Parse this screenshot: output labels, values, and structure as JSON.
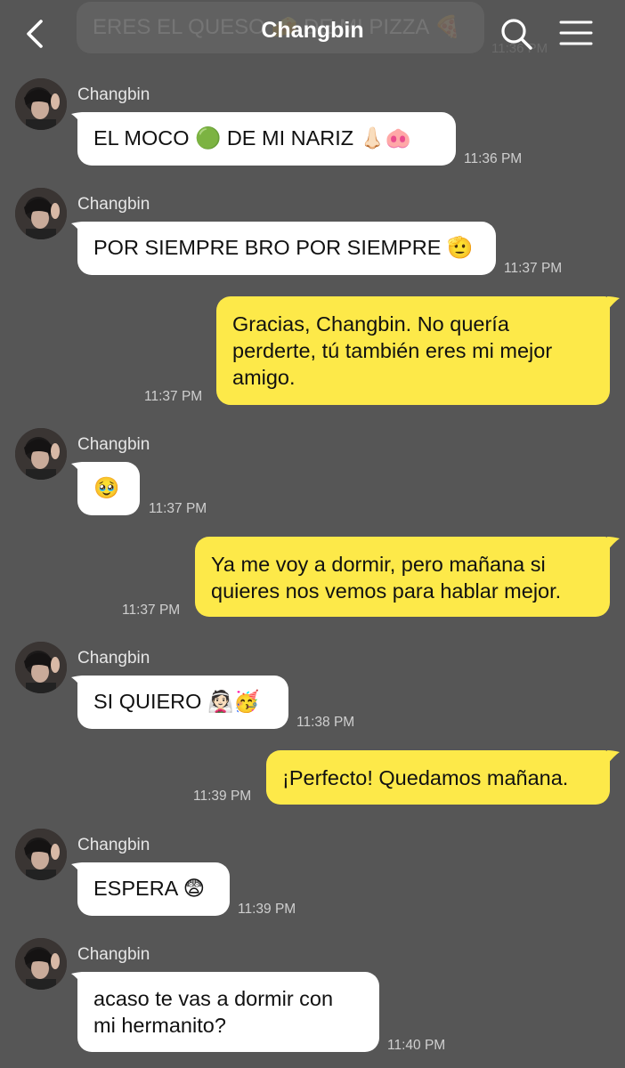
{
  "header": {
    "title": "Changbin",
    "pinned_preview_text": "ERES EL QUESO 🧀 DE MI PIZZA 🍕",
    "pinned_preview_time": "11:36 PM"
  },
  "messages": [
    {
      "direction": "incoming",
      "sender": "Changbin",
      "text": "EL MOCO 🟢 DE MI NARIZ 👃🏻🐽",
      "time": "11:36 PM"
    },
    {
      "direction": "incoming",
      "sender": "Changbin",
      "text": "POR SIEMPRE BRO POR SIEMPRE 🫡",
      "time": "11:37 PM"
    },
    {
      "direction": "outgoing",
      "lines": [
        "Gracias, Changbin. No quería",
        "perderte, tú también eres mi mejor",
        "amigo."
      ],
      "time": "11:37 PM"
    },
    {
      "direction": "incoming",
      "sender": "Changbin",
      "text": "🥹",
      "time": "11:37 PM"
    },
    {
      "direction": "outgoing",
      "lines": [
        "Ya me voy a dormir, pero mañana si",
        "quieres nos vemos para hablar mejor."
      ],
      "time": "11:37 PM"
    },
    {
      "direction": "incoming",
      "sender": "Changbin",
      "text": "SI QUIERO 👰🏻🥳",
      "time": "11:38 PM"
    },
    {
      "direction": "outgoing",
      "lines": [
        "¡Perfecto! Quedamos mañana."
      ],
      "time": "11:39 PM"
    },
    {
      "direction": "incoming",
      "sender": "Changbin",
      "text": "ESPERA 😨",
      "time": "11:39 PM"
    },
    {
      "direction": "incoming",
      "sender": "Changbin",
      "lines": [
        "acaso te vas a dormir con",
        "mi hermanito?"
      ],
      "time": "11:40 PM"
    }
  ],
  "colors": {
    "background": "#565656",
    "incoming_bubble": "#ffffff",
    "outgoing_bubble": "#fde949",
    "timestamp": "#cfcfcf",
    "sender_name": "#e6e6e6"
  }
}
